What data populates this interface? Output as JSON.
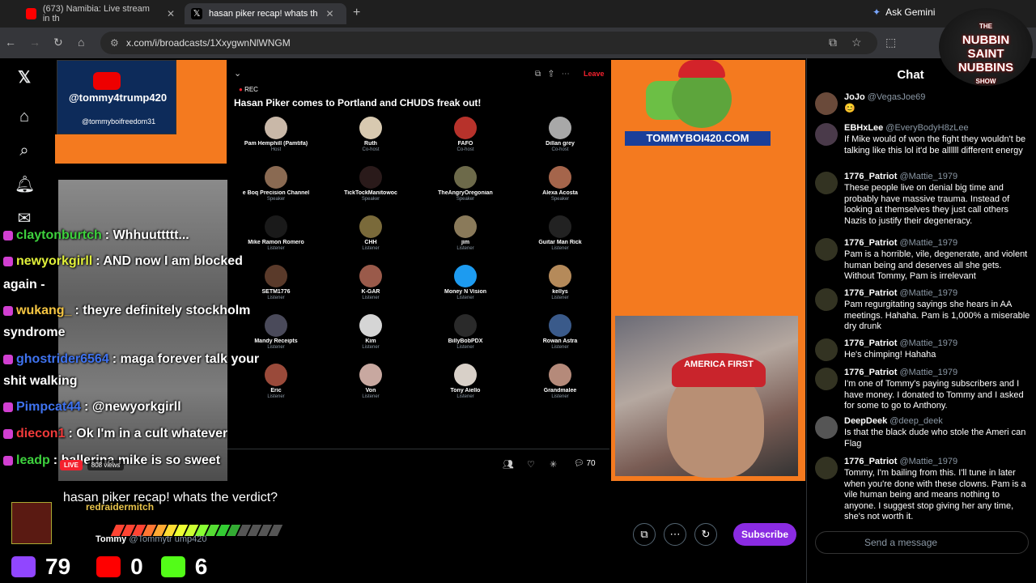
{
  "browser": {
    "tabs": [
      {
        "title": "(673) Namibia: Live stream in th",
        "active": false
      },
      {
        "title": "hasan piker recap! whats th",
        "active": true
      }
    ],
    "gemini_label": "Ask Gemini",
    "url": "x.com/i/broadcasts/1XxygwnNlWNGM"
  },
  "overlay": {
    "banner_handle": "@tommy4trump420",
    "banner_sub": "@tommyboifreedom31",
    "site": "TOMMYBOI420.COM",
    "hat_text": "AMERICA FIRST",
    "show_logo": [
      "THE",
      "NUBBIN",
      "SAINT",
      "NUBBINS",
      "SHOW"
    ],
    "counters": {
      "twitch": "79",
      "youtube": "0",
      "kick": "6"
    },
    "raider": "redraidermitch",
    "chat": [
      {
        "user": "claytonburtch",
        "color": "#3dd13d",
        "text": ": Whhuuttttt..."
      },
      {
        "user": "newyorkgirll",
        "color": "#e1f03a",
        "text": ": AND now I am blocked"
      },
      {
        "user": "",
        "color": "#fff",
        "text": "again -"
      },
      {
        "user": "wukang_",
        "color": "#f5c542",
        "text": ": theyre definitely stockholm"
      },
      {
        "user": "",
        "color": "#fff",
        "text": "syndrome"
      },
      {
        "user": "ghostrider6564",
        "color": "#3f73f0",
        "text": ": maga forever talk your"
      },
      {
        "user": "",
        "color": "#fff",
        "text": "shit walking"
      },
      {
        "user": "Pimpcat44",
        "color": "#3f73f0",
        "text": ": @newyorkgirll"
      },
      {
        "user": "diecon1",
        "color": "#f03a3a",
        "text": ": Ok I'm in a cult whatever"
      },
      {
        "user": "leadp",
        "color": "#3dd13d",
        "text": ": ballerina mike is so sweet"
      }
    ]
  },
  "space": {
    "rec": "REC",
    "title": "Hasan Piker comes to Portland and CHUDS freak out!",
    "leave": "Leave",
    "participants": [
      {
        "name": "Pam Hemphill (Pamtifa)",
        "role": "Host",
        "color": "#c9b8a8"
      },
      {
        "name": "Ruth",
        "role": "Co-host",
        "color": "#d8c9b0"
      },
      {
        "name": "FAFO",
        "role": "Co-host",
        "color": "#b7322b"
      },
      {
        "name": "Dillan grey",
        "role": "Co-host",
        "color": "#a8a8a8"
      },
      {
        "name": "e Boq Precision Channel",
        "role": "Speaker",
        "color": "#8a6a52"
      },
      {
        "name": "TickTockManitowoc",
        "role": "Speaker",
        "color": "#2a1a1a"
      },
      {
        "name": "TheAngryOregonian",
        "role": "Speaker",
        "color": "#6d6a4a"
      },
      {
        "name": "Alexa Acosta",
        "role": "Speaker",
        "color": "#a5654b"
      },
      {
        "name": "Mike Ramon Romero",
        "role": "Listener",
        "color": "#1a1a1a"
      },
      {
        "name": "CHH",
        "role": "Listener",
        "color": "#7a6a3a"
      },
      {
        "name": "jim",
        "role": "Listener",
        "color": "#8a7a5a"
      },
      {
        "name": "Guitar Man Rick",
        "role": "Listener",
        "color": "#222"
      },
      {
        "name": "SETM1776",
        "role": "Listener",
        "color": "#5a3a2a"
      },
      {
        "name": "K-GAR",
        "role": "Listener",
        "color": "#9a5a4a"
      },
      {
        "name": "Money N Vision",
        "role": "Listener",
        "color": "#1d9bf0"
      },
      {
        "name": "kellys",
        "role": "Listener",
        "color": "#b58a5a"
      },
      {
        "name": "Mandy Receipts",
        "role": "Listener",
        "color": "#4a4a5a"
      },
      {
        "name": "Kim",
        "role": "Listener",
        "color": "#d5d5d5"
      },
      {
        "name": "BillyBobPDX",
        "role": "Listener",
        "color": "#2a2a2a"
      },
      {
        "name": "Rowan Astra",
        "role": "Listener",
        "color": "#3a5a8a"
      },
      {
        "name": "Eric",
        "role": "Listener",
        "color": "#9a4a3a"
      },
      {
        "name": "Von",
        "role": "Listener",
        "color": "#c8a8a0"
      },
      {
        "name": "Tony Aiello",
        "role": "Listener",
        "color": "#d8d0c8"
      },
      {
        "name": "Grandmalee",
        "role": "Listener",
        "color": "#b58a7a"
      }
    ],
    "reply_count": "70",
    "live": "LIVE",
    "views": "808 views"
  },
  "broadcast": {
    "title": "hasan piker recap! whats the verdict?",
    "user": "@Tommytr ump420",
    "user_name": "Tommy",
    "subscribe": "Subscribe"
  },
  "chat": {
    "title": "Chat",
    "placeholder": "Send a message",
    "messages": [
      {
        "name": "JoJo",
        "handle": "@VegasJoe69",
        "text": "😊"
      },
      {
        "name": "EBHxLee",
        "handle": "@EveryBodyH8zLee",
        "text": "If Mike would of won the fight they wouldn't be talking like this lol it'd be allllll different energy"
      },
      {
        "name": "1776_Patriot",
        "handle": "@Mattie_1979",
        "text": "These people live on denial big time and probably have massive trauma. Instead of looking at themselves they just call others Nazis to justify their degeneracy."
      },
      {
        "name": "1776_Patriot",
        "handle": "@Mattie_1979",
        "text": "Pam is a horrible, vile, degenerate, and violent human being and deserves all she gets. Without Tommy, Pam is irrelevant"
      },
      {
        "name": "1776_Patriot",
        "handle": "@Mattie_1979",
        "text": "Pam regurgitating sayings she hears in AA meetings. Hahaha. Pam is 1,000% a miserable dry drunk"
      },
      {
        "name": "1776_Patriot",
        "handle": "@Mattie_1979",
        "text": "He's chimping! Hahaha"
      },
      {
        "name": "1776_Patriot",
        "handle": "@Mattie_1979",
        "text": "I'm one of Tommy's paying subscribers and I have money. I donated to Tommy and I asked for some to go to Anthony."
      },
      {
        "name": "DeepDeek",
        "handle": "@deep_deek",
        "text": "Is that the black dude who stole the Ameri can Flag"
      },
      {
        "name": "1776_Patriot",
        "handle": "@Mattie_1979",
        "text": "Tommy, I'm bailing from this. I'll tune in later when you're done with these clowns. Pam is a vile human being and means nothing to anyone. I suggest stop giving her any time, she's not worth it."
      }
    ]
  }
}
